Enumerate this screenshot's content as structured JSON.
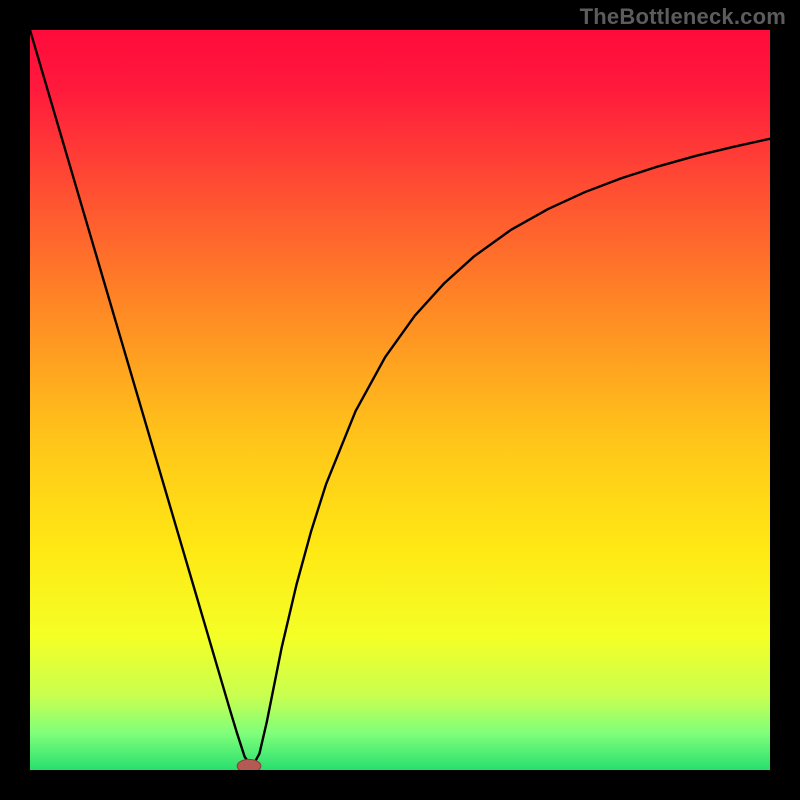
{
  "watermark": "TheBottleneck.com",
  "chart_data": {
    "type": "line",
    "title": "",
    "xlabel": "",
    "ylabel": "",
    "xlim": [
      0,
      100
    ],
    "ylim": [
      0,
      100
    ],
    "grid": false,
    "legend": false,
    "axes_visible": false,
    "background": {
      "type": "vertical_gradient",
      "stops": [
        {
          "offset": 0.0,
          "color": "#FF0B3B"
        },
        {
          "offset": 0.08,
          "color": "#FF1A3C"
        },
        {
          "offset": 0.22,
          "color": "#FF5032"
        },
        {
          "offset": 0.38,
          "color": "#FF8A24"
        },
        {
          "offset": 0.55,
          "color": "#FFC41A"
        },
        {
          "offset": 0.7,
          "color": "#FFE814"
        },
        {
          "offset": 0.82,
          "color": "#F4FF26"
        },
        {
          "offset": 0.9,
          "color": "#C8FF50"
        },
        {
          "offset": 0.95,
          "color": "#80FF7A"
        },
        {
          "offset": 1.0,
          "color": "#27DF6E"
        }
      ]
    },
    "series": [
      {
        "name": "curve",
        "color": "#000000",
        "width": 2.4,
        "x": [
          0,
          2,
          4,
          6,
          8,
          10,
          12,
          14,
          16,
          18,
          20,
          22,
          24,
          26,
          27,
          28,
          29,
          30,
          31,
          32,
          34,
          36,
          38,
          40,
          44,
          48,
          52,
          56,
          60,
          65,
          70,
          75,
          80,
          85,
          90,
          95,
          100
        ],
        "y": [
          100,
          93.2,
          86.4,
          79.6,
          72.8,
          66.0,
          59.2,
          52.4,
          45.6,
          38.8,
          32.0,
          25.2,
          18.4,
          11.6,
          8.2,
          4.9,
          1.8,
          0.4,
          2.2,
          6.5,
          16.5,
          25.0,
          32.3,
          38.6,
          48.5,
          55.8,
          61.4,
          65.8,
          69.4,
          73.0,
          75.8,
          78.1,
          80.0,
          81.6,
          83.0,
          84.2,
          85.3
        ]
      }
    ],
    "marker": {
      "name": "min-marker",
      "x": 29.6,
      "y": 0.0,
      "rx": 1.6,
      "ry": 0.9,
      "fill": "#B35A55",
      "stroke": "#8E3B36"
    }
  }
}
